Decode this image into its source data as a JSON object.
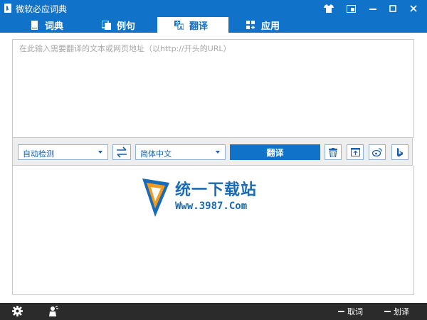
{
  "window": {
    "title": "微软必应词典"
  },
  "tabs": [
    {
      "label": "词典",
      "icon": "book-icon"
    },
    {
      "label": "例句",
      "icon": "copy-icon"
    },
    {
      "label": "翻译",
      "icon": "translate-icon",
      "active": true
    },
    {
      "label": "应用",
      "icon": "apps-icon"
    }
  ],
  "translator": {
    "input_placeholder": "在此输入需要翻译的文本或网页地址（以http://开头的URL）",
    "source_language": "自动检测",
    "target_language": "简体中文",
    "translate_label": "翻译"
  },
  "watermark": {
    "brand": "统一下载站",
    "url": "Www.3987.Com"
  },
  "statusbar": {
    "item_1": "取词",
    "item_2": "划译"
  },
  "colors": {
    "accent": "#1172c9",
    "statusbar_bg": "#2b2b2b"
  }
}
